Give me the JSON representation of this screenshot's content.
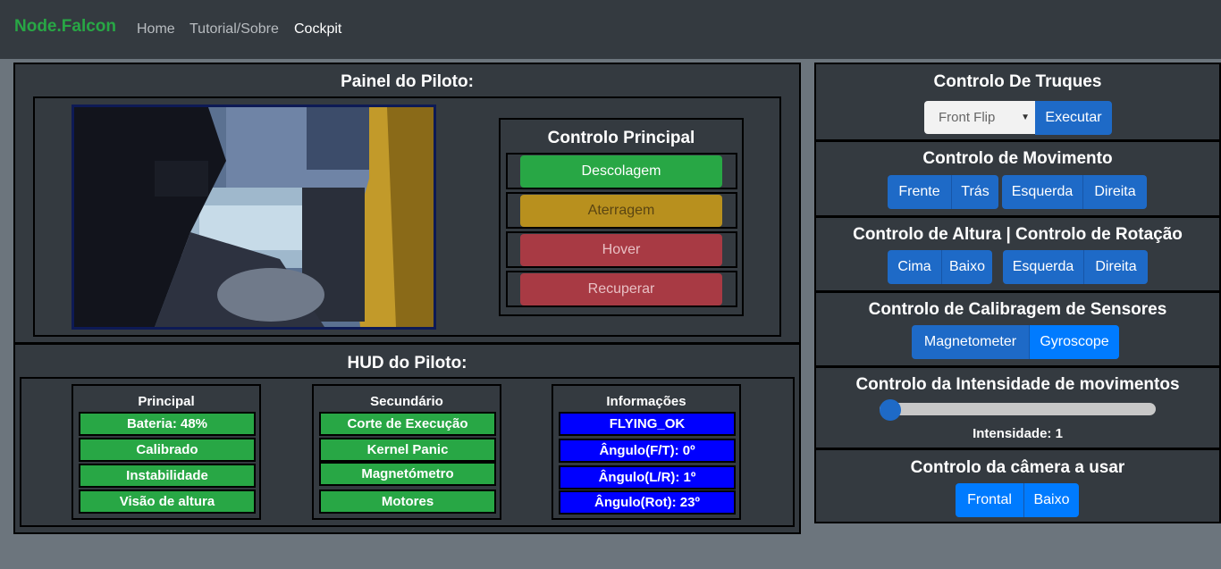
{
  "nav": {
    "brand": "Node.Falcon",
    "links": [
      "Home",
      "Tutorial/Sobre",
      "Cockpit"
    ]
  },
  "pilot_panel": {
    "title": "Painel do Piloto:",
    "main_control": {
      "title": "Controlo Principal",
      "buttons": [
        "Descolagem",
        "Aterragem",
        "Hover",
        "Recuperar"
      ]
    }
  },
  "hud": {
    "title": "HUD do Piloto:",
    "principal": {
      "title": "Principal",
      "items": [
        "Bateria: 48%",
        "Calibrado",
        "Instabilidade",
        "Visão de altura"
      ]
    },
    "secundario": {
      "title": "Secundário",
      "items": [
        "Corte de Execução",
        "Kernel Panic",
        "Magnetómetro",
        "Motores"
      ]
    },
    "informacoes": {
      "title": "Informações",
      "items": [
        "FLYING_OK",
        "Ângulo(F/T): 0º",
        "Ângulo(L/R): 1º",
        "Ângulo(Rot): 23º"
      ]
    }
  },
  "tricks": {
    "title": "Controlo De Truques",
    "select_value": "Front Flip",
    "execute": "Executar"
  },
  "movement": {
    "title": "Controlo de Movimento",
    "group1": [
      "Frente",
      "Trás"
    ],
    "group2": [
      "Esquerda",
      "Direita"
    ]
  },
  "altitude": {
    "title": "Controlo de Altura | Controlo de Rotação",
    "group1": [
      "Cima",
      "Baixo"
    ],
    "group2": [
      "Esquerda",
      "Direita"
    ]
  },
  "calibration": {
    "title": "Controlo de Calibragem de Sensores",
    "buttons": [
      "Magnetometer",
      "Gyroscope"
    ]
  },
  "intensity": {
    "title": "Controlo da Intensidade de movimentos",
    "label": "Intensidade: 1",
    "value": 1
  },
  "camera": {
    "title": "Controlo da câmera a usar",
    "buttons": [
      "Frontal",
      "Baixo"
    ]
  },
  "colors": {
    "navbar": "#343a40",
    "success": "#28a745",
    "warning": "#b8901e",
    "danger": "#a83a44",
    "primary": "#1e6ac7",
    "primary_active": "#007bff",
    "hud_blue": "#0000ff"
  }
}
